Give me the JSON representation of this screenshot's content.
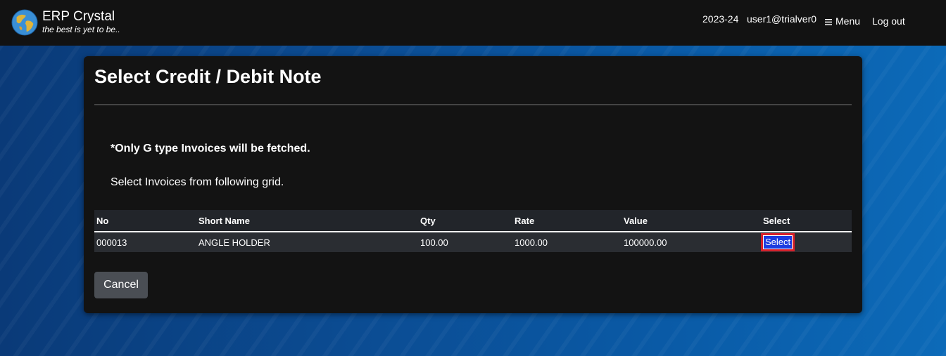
{
  "brand": {
    "title": "ERP Crystal",
    "tagline": "the best is yet to be.."
  },
  "nav": {
    "year": "2023-24",
    "user": "user1@trialver0",
    "menu": "Menu",
    "logout": "Log out"
  },
  "page": {
    "title": "Select Credit / Debit Note",
    "note": "*Only G type Invoices will be fetched.",
    "instruction": "Select Invoices from following grid."
  },
  "grid": {
    "headers": [
      "No",
      "Short Name",
      "Qty",
      "Rate",
      "Value",
      "Select"
    ],
    "rows": [
      {
        "no": "000013",
        "short_name": "ANGLE HOLDER",
        "qty": "100.00",
        "rate": "1000.00",
        "value": "100000.00",
        "action": "Select"
      }
    ]
  },
  "buttons": {
    "cancel": "Cancel"
  },
  "colors": {
    "select_button": "#1c3ce0",
    "highlight_border": "#d6202a",
    "topbar": "#121212"
  }
}
